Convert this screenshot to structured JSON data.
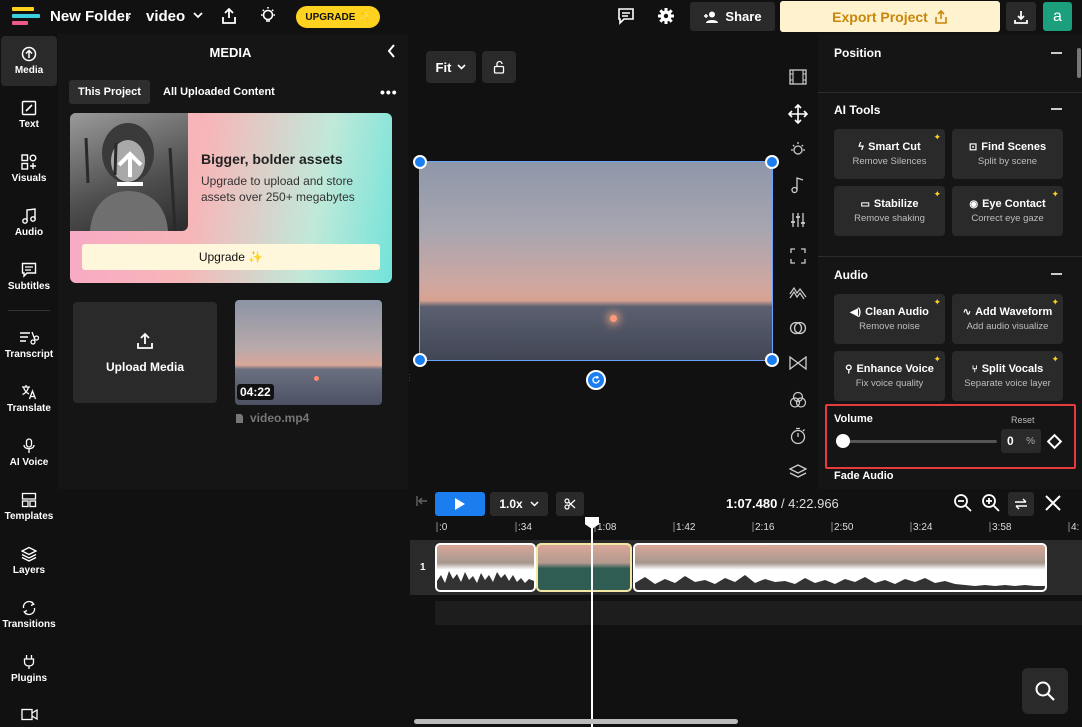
{
  "topbar": {
    "folder": "New Folder",
    "project": "video",
    "upgrade_label": "UPGRADE ✨",
    "share_label": "Share",
    "export_label": "Export Project",
    "avatar_letter": "a"
  },
  "nav": {
    "items": [
      {
        "label": "Media",
        "icon": "upload-icon"
      },
      {
        "label": "Text",
        "icon": "pen-icon"
      },
      {
        "label": "Visuals",
        "icon": "grid-icon"
      },
      {
        "label": "Audio",
        "icon": "music-note-icon"
      },
      {
        "label": "Subtitles",
        "icon": "subtitles-icon"
      },
      {
        "label": "Transcript",
        "icon": "transcript-icon"
      },
      {
        "label": "Translate",
        "icon": "translate-icon"
      },
      {
        "label": "AI Voice",
        "icon": "microphone-icon"
      },
      {
        "label": "Templates",
        "icon": "templates-icon"
      },
      {
        "label": "Layers",
        "icon": "layers-icon"
      },
      {
        "label": "Transitions",
        "icon": "transitions-icon"
      },
      {
        "label": "Plugins",
        "icon": "plug-icon"
      }
    ]
  },
  "media": {
    "title": "MEDIA",
    "tabs": [
      "This Project",
      "All Uploaded Content"
    ],
    "card_heading": "Bigger, bolder assets",
    "card_text": "Upgrade to upload and store assets over 250+ megabytes",
    "card_button": "Upgrade ✨",
    "upload_label": "Upload Media",
    "video_duration": "04:22",
    "video_name": "video.mp4"
  },
  "preview": {
    "fit_label": "Fit"
  },
  "right": {
    "position_title": "Position",
    "ai_tools_title": "AI Tools",
    "ai_tools": [
      {
        "title": "Smart Cut",
        "sub": "Remove Silences"
      },
      {
        "title": "Find Scenes",
        "sub": "Split by scene"
      },
      {
        "title": "Stabilize",
        "sub": "Remove shaking"
      },
      {
        "title": "Eye Contact",
        "sub": "Correct eye gaze"
      }
    ],
    "audio_title": "Audio",
    "audio_tools": [
      {
        "title": "Clean Audio",
        "sub": "Remove noise"
      },
      {
        "title": "Add Waveform",
        "sub": "Add audio visualize"
      },
      {
        "title": "Enhance Voice",
        "sub": "Fix voice quality"
      },
      {
        "title": "Split Vocals",
        "sub": "Separate voice layer"
      }
    ],
    "volume_label": "Volume",
    "reset_label": "Reset",
    "volume_value": "0",
    "volume_unit": "%",
    "volume_fraction": 0,
    "fade_label": "Fade Audio"
  },
  "timeline": {
    "speed": "1.0x",
    "current_time": "1:07.480",
    "total_time": "/ 4:22.966",
    "track_number": "1",
    "ruler": [
      ":0",
      ":34",
      "1:08",
      "1:42",
      "2:16",
      "2:50",
      "3:24",
      "3:58",
      "4:"
    ]
  },
  "colors": {
    "accent": "#1a7df0",
    "upgrade": "#ffd21f",
    "export_bg": "#fff3cf",
    "export_text": "#c8860a",
    "highlight_border": "#e53b3b",
    "avatar": "#1c9f7c"
  }
}
